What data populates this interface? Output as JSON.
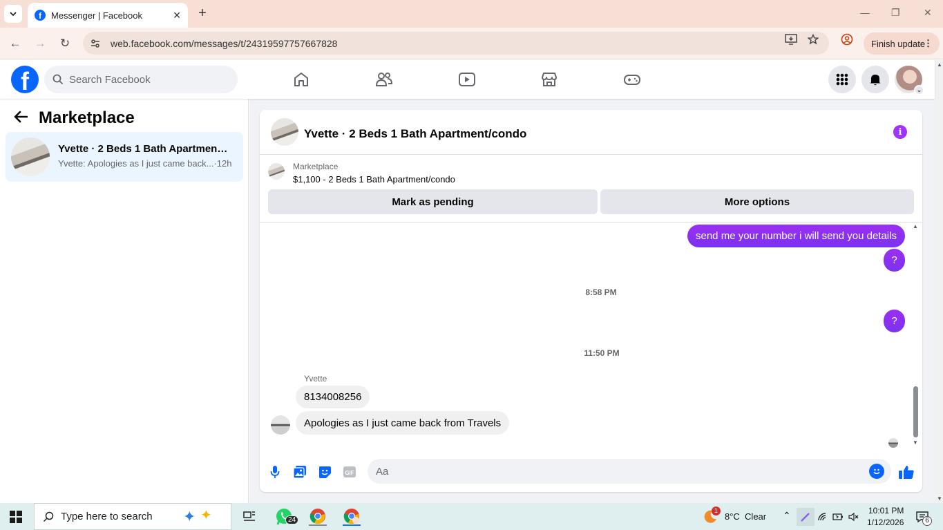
{
  "browser": {
    "tab_title": "Messenger | Facebook",
    "url": "web.facebook.com/messages/t/24319597757667828",
    "finish_update": "Finish update"
  },
  "fb": {
    "logo_letter": "f",
    "search_placeholder": "Search Facebook"
  },
  "left_panel": {
    "title": "Marketplace",
    "conversation": {
      "name": "Yvette · 2 Beds 1 Bath Apartment/...",
      "snippet": "Yvette: Apologies as I just came back...·12h"
    }
  },
  "chat": {
    "title": "Yvette · 2 Beds 1 Bath Apartment/condo",
    "marketplace_label": "Marketplace",
    "listing": "$1,100 - 2 Beds 1 Bath Apartment/condo",
    "mark_pending": "Mark as pending",
    "more_options": "More options",
    "messages": {
      "out1": "send me your number i will send you details",
      "out2": "?",
      "time1": "8:58 PM",
      "out3": "?",
      "time2": "11:50 PM",
      "sender": "Yvette",
      "in1": "8134008256",
      "in2": "Apologies as I just came back from Travels"
    },
    "composer_placeholder": "Aa"
  },
  "taskbar": {
    "search_placeholder": "Type here to search",
    "whatsapp_badge": "24",
    "weather": "8°C  Clear",
    "weather_badge": "1",
    "time": "10:01 PM",
    "date": "1/12/2026",
    "notif_count": "6"
  },
  "colors": {
    "fb_blue": "#0866ff",
    "messenger_purple": "#8a2be2"
  }
}
